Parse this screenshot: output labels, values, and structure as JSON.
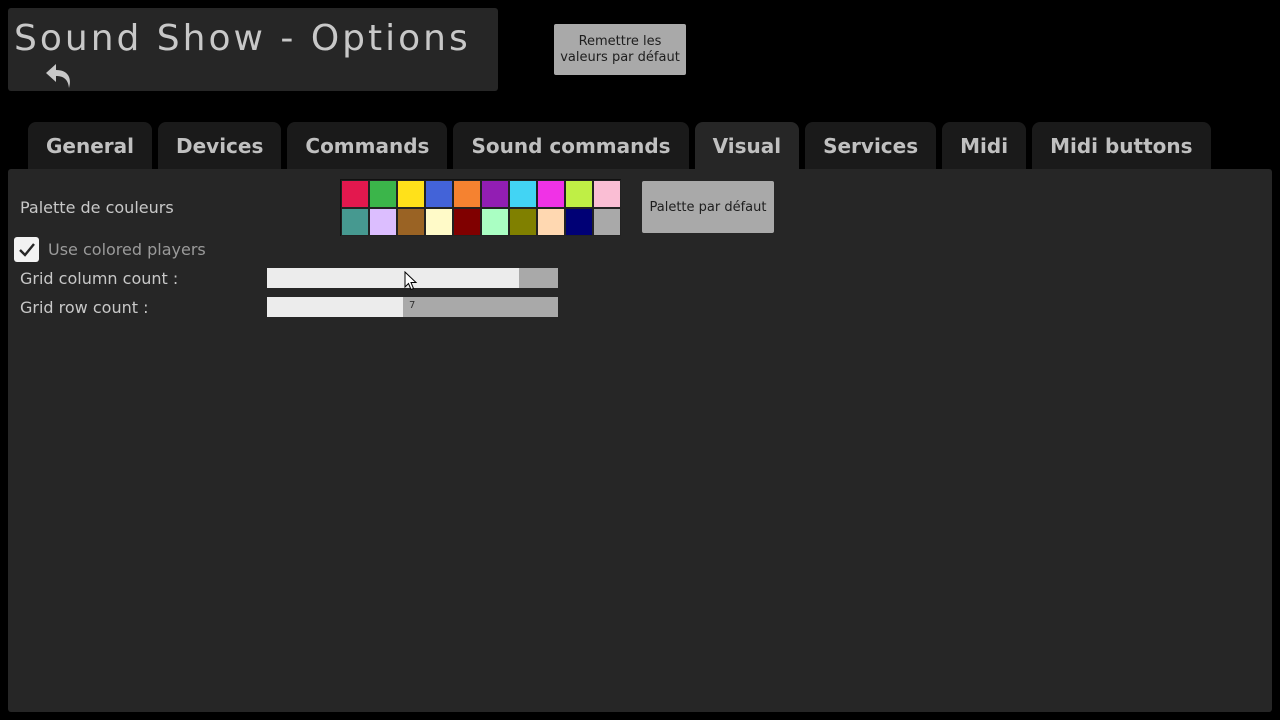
{
  "header": {
    "title": "Sound Show - Options",
    "back_icon": "undo-arrow-icon",
    "reset_label": "Remettre les valeurs par défaut"
  },
  "tabs": [
    {
      "label": "General"
    },
    {
      "label": "Devices"
    },
    {
      "label": "Commands"
    },
    {
      "label": "Sound commands"
    },
    {
      "label": "Visual",
      "active": true
    },
    {
      "label": "Services"
    },
    {
      "label": "Midi"
    },
    {
      "label": "Midi buttons"
    }
  ],
  "visual": {
    "palette_label": "Palette de couleurs",
    "palette_colors": [
      "#e3184e",
      "#3bb54a",
      "#ffe11a",
      "#4363d8",
      "#f58230",
      "#921eb3",
      "#42d4f4",
      "#f032e6",
      "#bfef45",
      "#fabed4",
      "#469990",
      "#dcbeff",
      "#9a6324",
      "#fffac8",
      "#800000",
      "#aaffc3",
      "#808000",
      "#ffd8b1",
      "#000075",
      "#a9a9a9"
    ],
    "palette_default_label": "Palette par défaut",
    "use_colored_players_label": "Use colored players",
    "use_colored_players_checked": true,
    "grid_column_label": "Grid column count :",
    "grid_column_value": "",
    "grid_column_fraction": 0.866,
    "grid_row_label": "Grid row count :",
    "grid_row_value": "7",
    "grid_row_fraction": 0.467
  },
  "colors": {
    "background": "#000000",
    "panel": "#262626",
    "tab_inactive": "#1a1a1a",
    "button": "#a9a9a9"
  }
}
